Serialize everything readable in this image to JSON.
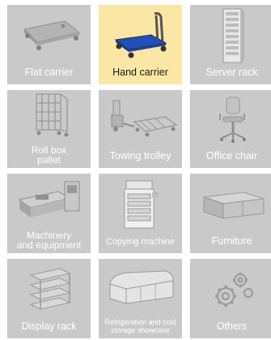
{
  "categories": [
    {
      "label": "Flat carrier",
      "icon": "flat-carrier-icon",
      "selected": false
    },
    {
      "label": "Hand carrier",
      "icon": "hand-carrier-icon",
      "selected": true
    },
    {
      "label": "Server rack",
      "icon": "server-rack-icon",
      "selected": false
    },
    {
      "label": "Roll box\npallet",
      "icon": "roll-box-pallet-icon",
      "selected": false
    },
    {
      "label": "Towing trolley",
      "icon": "towing-trolley-icon",
      "selected": false
    },
    {
      "label": "Office chair",
      "icon": "office-chair-icon",
      "selected": false
    },
    {
      "label": "Machinery\nand equipment",
      "icon": "machinery-icon",
      "selected": false
    },
    {
      "label": "Copying machine",
      "icon": "copying-machine-icon",
      "selected": false
    },
    {
      "label": "Furniture",
      "icon": "furniture-icon",
      "selected": false
    },
    {
      "label": "Display rack",
      "icon": "display-rack-icon",
      "selected": false
    },
    {
      "label": "Refrigeration and cold\nstorage showcase",
      "icon": "refrigeration-showcase-icon",
      "selected": false
    },
    {
      "label": "Others",
      "icon": "gears-icon",
      "selected": false
    }
  ],
  "colors": {
    "tile": "#c9c9c9",
    "tile_selected": "#fae7a6",
    "label": "#ffffff",
    "label_selected": "#1a1a1a",
    "accent_blue": "#1f4fb8"
  }
}
